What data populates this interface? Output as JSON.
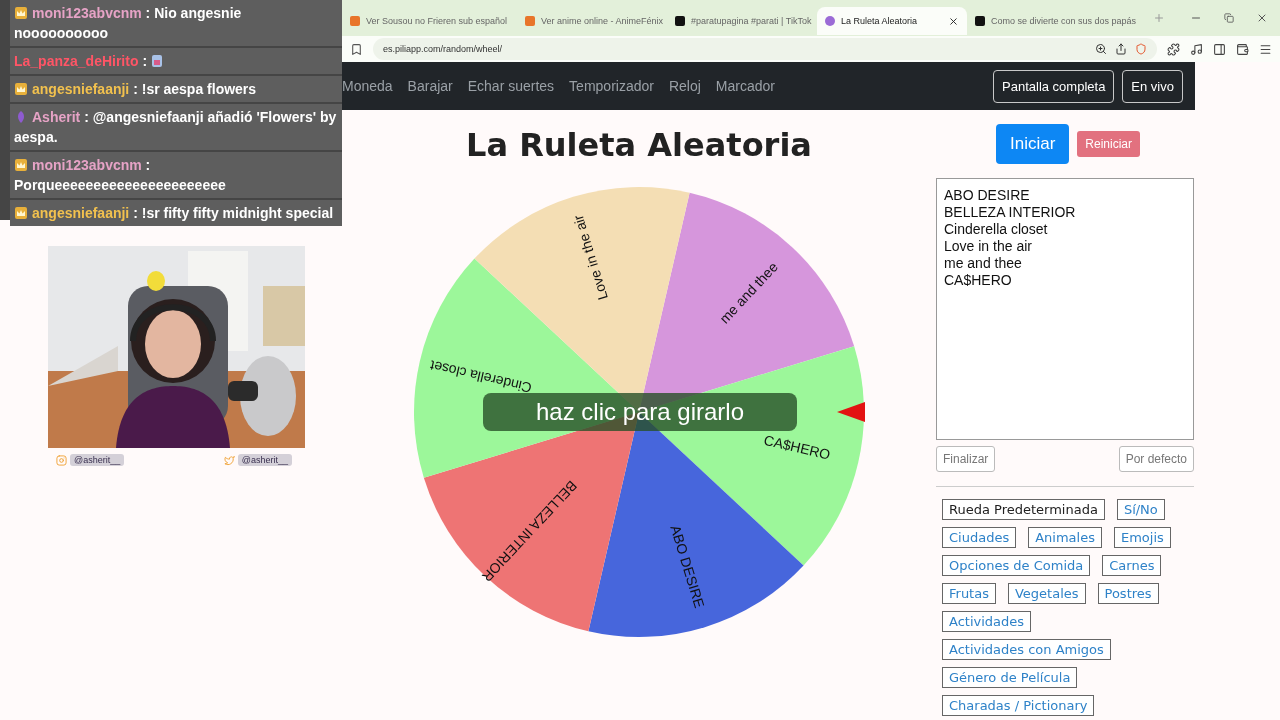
{
  "chat": [
    {
      "user": "moni123abvcnm",
      "color": "#e6a3c6",
      "kind": "crown",
      "sep": ":",
      "text": "Nio angesnie noooooooooo",
      "emote": false
    },
    {
      "user": "La_panza_deHirito",
      "color": "#ff5566",
      "kind": "plain",
      "sep": ":",
      "emote": true
    },
    {
      "user": "angesniefaanji",
      "color": "#f2c14e",
      "kind": "crown",
      "sep": ":",
      "text": "!sr aespa flowers",
      "emote": false
    },
    {
      "user": "Asherit",
      "color": "#e6a3c6",
      "kind": "gem",
      "sep": ":",
      "text": "@angesniefaanji añadió 'Flowers' by aespa.",
      "emote": false
    },
    {
      "user": "moni123abvcnm",
      "color": "#e6a3c6",
      "kind": "crown",
      "sep": ":",
      "text": "Porqueeeeeeeeeeeeeeeeeeeeee",
      "emote": false
    },
    {
      "user": "angesniefaanji",
      "color": "#f2c14e",
      "kind": "crown",
      "sep": ":",
      "text": "!sr fifty fifty midnight special",
      "emote": false
    }
  ],
  "webcam": {
    "kind": "picture",
    "socials": [
      {
        "kind": "instagram",
        "handle": "@asherit__"
      },
      {
        "kind": "twitter",
        "handle": "@asherit__"
      }
    ]
  },
  "tabs": [
    {
      "title": "Ver Sousou no Frieren sub español",
      "selected": false
    },
    {
      "title": "Ver anime online - AnimeFénix",
      "selected": false
    },
    {
      "title": "#paratupagina #parati | TikTok",
      "selected": false
    },
    {
      "title": "La Ruleta Aleatoria",
      "selected": true
    },
    {
      "title": "Como se divierte con sus dos papás",
      "selected": false
    }
  ],
  "address": "es.piliapp.com/random/wheel/",
  "nav": [
    "Moneda",
    "Barajar",
    "Echar suertes",
    "Temporizador",
    "Reloj",
    "Marcador"
  ],
  "nav_buttons": [
    "Pantalla completa",
    "En vivo"
  ],
  "title": "La Ruleta Aleatoria",
  "wheel": {
    "hint": "haz clic para girarlo",
    "segments": [
      {
        "label": "me and thee",
        "color": "#d696dc"
      },
      {
        "label": "CA$HERO",
        "color": "#9cf79a"
      },
      {
        "label": "ABO DESIRE",
        "color": "#4766dc"
      },
      {
        "label": "BELLEZA INTERIOR",
        "color": "#ee7474"
      },
      {
        "label": "Cinderella closet",
        "color": "#9cf79a"
      },
      {
        "label": "Love in the air",
        "color": "#f4deb4"
      }
    ]
  },
  "start_button": "Iniciar",
  "reset_button": "Reiniciar",
  "entries": [
    "ABO DESIRE",
    "BELLEZA INTERIOR",
    "Cinderella closet",
    "Love in the air",
    "me and thee",
    "CA$HERO"
  ],
  "finish_button": "Finalizar",
  "default_button": "Por defecto",
  "presets": [
    {
      "label": "Rueda Predeterminada",
      "selected": true
    },
    {
      "label": "Sí/No",
      "selected": false
    },
    {
      "label": "Ciudades",
      "selected": false
    },
    {
      "label": "Animales",
      "selected": false
    },
    {
      "label": "Emojis",
      "selected": false
    },
    {
      "label": "Opciones de Comida",
      "selected": false
    },
    {
      "label": "Carnes",
      "selected": false
    },
    {
      "label": "Frutas",
      "selected": false
    },
    {
      "label": "Vegetales",
      "selected": false
    },
    {
      "label": "Postres",
      "selected": false
    },
    {
      "label": "Actividades",
      "selected": false
    },
    {
      "label": "Actividades con Amigos",
      "selected": false
    },
    {
      "label": "Género de Película",
      "selected": false
    },
    {
      "label": "Charadas / Pictionary",
      "selected": false
    }
  ]
}
